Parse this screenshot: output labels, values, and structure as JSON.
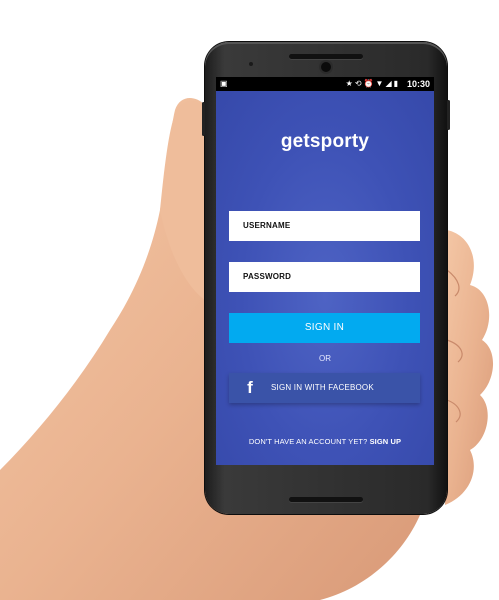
{
  "status_bar": {
    "time": "10:30",
    "icons": [
      "notification-icon",
      "star-icon",
      "sync-icon",
      "alarm-icon",
      "wifi-icon",
      "signal-icon",
      "battery-icon"
    ]
  },
  "app": {
    "logo": "getsporty",
    "username_placeholder": "USERNAME",
    "password_placeholder": "PASSWORD",
    "signin_label": "SIGN IN",
    "or_label": "OR",
    "facebook_label": "SIGN IN WITH FACEBOOK",
    "signup_prompt": "DON'T HAVE AN ACCOUNT YET?",
    "signup_link": "SIGN UP"
  },
  "colors": {
    "background": "#3d51b4",
    "signin_button": "#02aaf0",
    "facebook_button": "#3a53a8",
    "field": "#ffffff"
  }
}
